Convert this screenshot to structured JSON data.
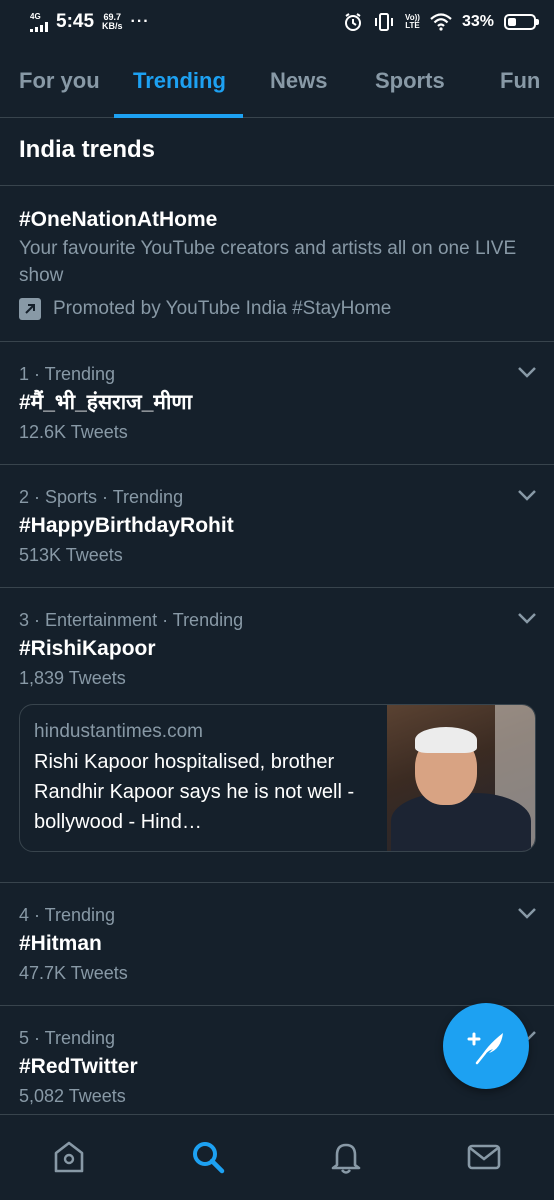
{
  "status_bar": {
    "network": "4G",
    "time": "5:45",
    "speed_value": "69.7",
    "speed_unit": "KB/s",
    "more": "···",
    "volte_top": "Vo))",
    "volte_bottom": "LTE",
    "battery_percent": "33%",
    "battery_level": 0.33
  },
  "tabs": [
    {
      "label": "For you",
      "active": false
    },
    {
      "label": "Trending",
      "active": true
    },
    {
      "label": "News",
      "active": false
    },
    {
      "label": "Sports",
      "active": false
    },
    {
      "label": "Fun",
      "active": false
    }
  ],
  "section_title": "India trends",
  "promo": {
    "hashtag": "#OneNationAtHome",
    "description": "Your favourite YouTube creators and artists all on one LIVE show",
    "promoted_text": "Promoted by YouTube India #StayHome"
  },
  "trends": [
    {
      "meta": "1 · Trending",
      "name": "#मैं_भी_हंसराज_मीणा",
      "count": "12.6K Tweets"
    },
    {
      "meta": "2 · Sports · Trending",
      "name": "#HappyBirthdayRohit",
      "count": "513K Tweets"
    },
    {
      "meta": "3 · Entertainment · Trending",
      "name": "#RishiKapoor",
      "count": "1,839 Tweets",
      "card": {
        "domain": "hindustantimes.com",
        "headline": "Rishi Kapoor hospitalised, brother Randhir Kapoor says he is not well - bollywood - Hind…"
      }
    },
    {
      "meta": "4 · Trending",
      "name": "#Hitman",
      "count": "47.7K Tweets"
    },
    {
      "meta": "5 · Trending",
      "name": "#RedTwitter",
      "count": "5,082 Tweets"
    }
  ],
  "colors": {
    "background": "#15202b",
    "accent": "#1da1f2",
    "secondary_text": "#8899a6",
    "divider": "#38444d"
  },
  "icons": {
    "fab": "compose-tweet-icon",
    "nav": [
      "home-icon",
      "search-icon",
      "notifications-bell-icon",
      "messages-mail-icon"
    ],
    "active_nav": "search-icon"
  }
}
